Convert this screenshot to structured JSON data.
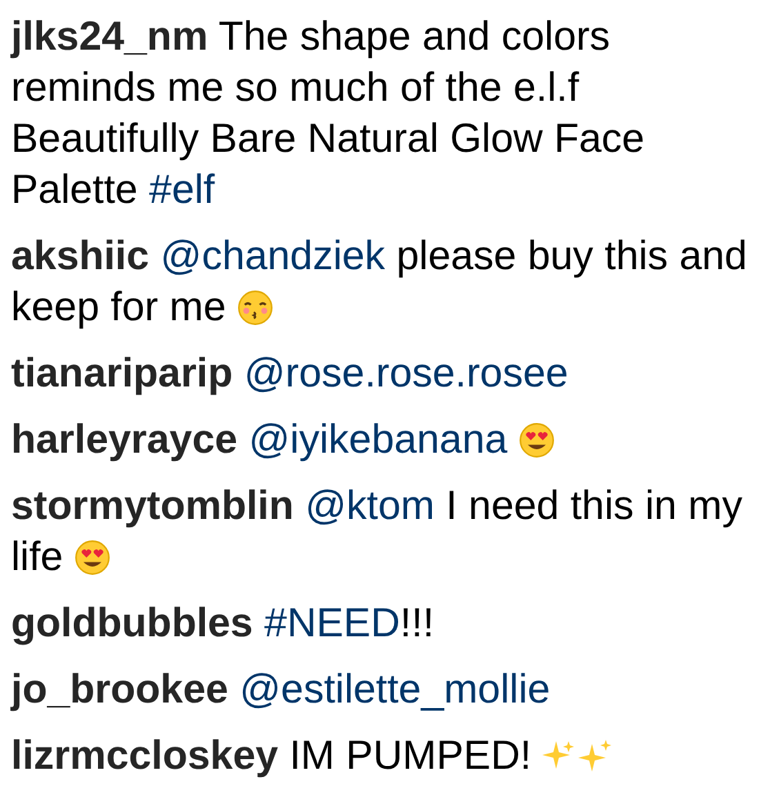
{
  "comments": [
    {
      "username": "jlks24_nm",
      "parts": [
        {
          "kind": "text",
          "text": "The shape and colors reminds me so much of the e.l.f Beautifully Bare Natural Glow Face Palette"
        },
        {
          "kind": "link",
          "text": "#elf"
        }
      ]
    },
    {
      "username": "akshiic",
      "parts": [
        {
          "kind": "link",
          "text": "@chandziek"
        },
        {
          "kind": "text",
          "text": "please buy this and keep for me"
        },
        {
          "kind": "kiss"
        }
      ]
    },
    {
      "username": "tianariparip",
      "parts": [
        {
          "kind": "link",
          "text": "@rose.rose.rosee"
        }
      ]
    },
    {
      "username": "harleyrayce",
      "parts": [
        {
          "kind": "link",
          "text": "@iyikebanana"
        },
        {
          "kind": "hearteyes"
        }
      ]
    },
    {
      "username": "stormytomblin",
      "parts": [
        {
          "kind": "link",
          "text": "@ktom"
        },
        {
          "kind": "text",
          "text": "I need this in my life"
        },
        {
          "kind": "hearteyes"
        }
      ]
    },
    {
      "username": "goldbubbles",
      "parts": [
        {
          "kind": "link",
          "text": "#NEED"
        },
        {
          "kind": "tail",
          "text": "!!!"
        }
      ]
    },
    {
      "username": "jo_brookee",
      "parts": [
        {
          "kind": "link",
          "text": "@estilette_mollie"
        }
      ]
    },
    {
      "username": "lizrmccloskey",
      "parts": [
        {
          "kind": "text",
          "text": "IM PUMPED!"
        },
        {
          "kind": "sparkles"
        }
      ]
    }
  ]
}
